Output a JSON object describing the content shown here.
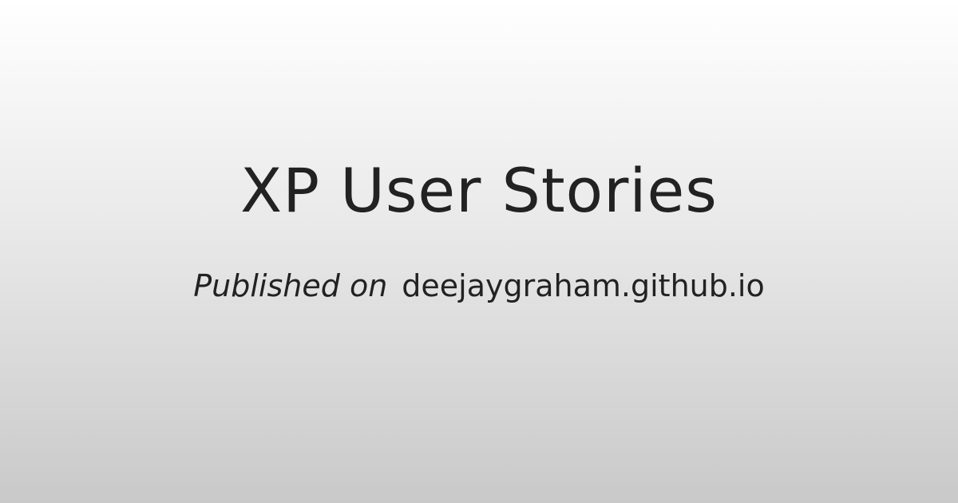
{
  "title": "XP User Stories",
  "subtitle": {
    "prefix": "Published on",
    "site": "deejaygraham.github.io"
  },
  "colors": {
    "text": "#222222",
    "background_top": "#ffffff",
    "background_bottom": "#c9c9c9"
  }
}
